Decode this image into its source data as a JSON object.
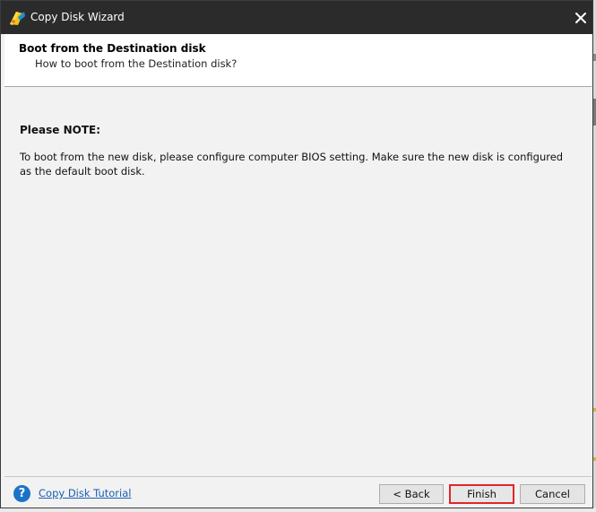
{
  "window": {
    "title": "Copy Disk Wizard",
    "icon": "copy-disk-wizard-app-icon",
    "close_icon": "close-icon"
  },
  "header": {
    "title": "Boot from the Destination disk",
    "subtitle": "How to boot from the Destination disk?"
  },
  "content": {
    "note_title": "Please NOTE:",
    "note_body": "To boot from the new disk, please configure computer BIOS setting. Make sure the new disk is configured as the default boot disk."
  },
  "footer": {
    "help_icon": "question-icon",
    "help_icon_glyph": "?",
    "tutorial_link": "Copy Disk Tutorial",
    "buttons": {
      "back": "< Back",
      "finish": "Finish",
      "cancel": "Cancel"
    }
  },
  "colors": {
    "titlebar": "#2b2b2b",
    "window_bg": "#f2f2f2",
    "header_bg": "#ffffff",
    "link": "#1a5fb4",
    "help_icon": "#1a73c8",
    "finish_highlight": "#e0262b"
  }
}
